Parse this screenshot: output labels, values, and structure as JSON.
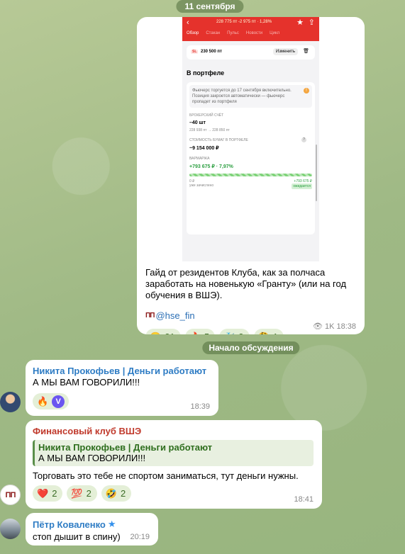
{
  "date_pill": "11 сентября",
  "screenshot": {
    "top_values": "228 775 пт  -2 975 пт · 1,28%",
    "tabs": [
      "Обзор",
      "Стакан",
      "Пульс",
      "Новости",
      "Цикл"
    ],
    "sl_badge": "SL",
    "sl_value": "230 500 пт",
    "sl_button": "Изменить",
    "portfolio_title": "В портфеле",
    "warning": "Фьючерс торгуется до 17 сентября включительно. Позиция закроется автоматически — фьючерс пропадет из портфеля",
    "broker_label": "БРОКЕРСКИЙ СЧЁТ",
    "broker_qty": "–40 шт",
    "broker_prices": "228 938 пт → 228 850 пт",
    "value_label": "СТОИМОСТЬ БУМАГ В ПОРТФЕЛЕ",
    "value": "~9 154 000 ₽",
    "margin_label": "ВАРМАРЖА",
    "margin_value": "+793 675 ₽ · 7,97%",
    "credited_left_value": "0 ₽",
    "credited_left_label": "уже зачислено",
    "credited_right_value": "+793 675 ₽",
    "credited_right_label": "ожидается"
  },
  "post": {
    "text": "Гайд от резидентов Клуба, как за полчаса заработать на новенькую «Гранту» (или на год обучения в ВШЭ).",
    "signature": "@hse_fin",
    "views": "1K",
    "time": "18:38",
    "reactions": [
      {
        "emoji": "😁",
        "count": "31"
      },
      {
        "emoji": "🔥",
        "count": "5"
      },
      {
        "emoji": "🐳",
        "count": "3"
      },
      {
        "emoji": "🤔",
        "count": "1"
      }
    ]
  },
  "discussion_label": "Начало обсуждения",
  "messages": [
    {
      "sender": "Никита Прокофьев | Деньги работают",
      "sender_color": "#2e7cc4",
      "text": "А МЫ ВАМ ГОВОРИЛИ!!!",
      "reaction_emoji": "🔥",
      "reaction_v": "V",
      "time": "18:39"
    },
    {
      "sender": "Финансовый клуб ВШЭ",
      "sender_color": "#c0392b",
      "quote_sender": "Никита Прокофьев | Деньги работают",
      "quote_text": "А МЫ ВАМ ГОВОРИЛИ!!!",
      "text": "Торговать это тебе не спортом заниматься, тут деньги нужны.",
      "reactions": [
        {
          "emoji": "❤️",
          "count": "2"
        },
        {
          "emoji": "💯",
          "count": "2"
        },
        {
          "emoji": "🤣",
          "count": "2"
        }
      ],
      "time": "18:41"
    },
    {
      "sender": "Пётр Коваленко",
      "sender_color": "#2e7cc4",
      "text": "стоп дышит в спину)",
      "time": "20:19"
    }
  ],
  "avatar2_text": "ΠΠ"
}
